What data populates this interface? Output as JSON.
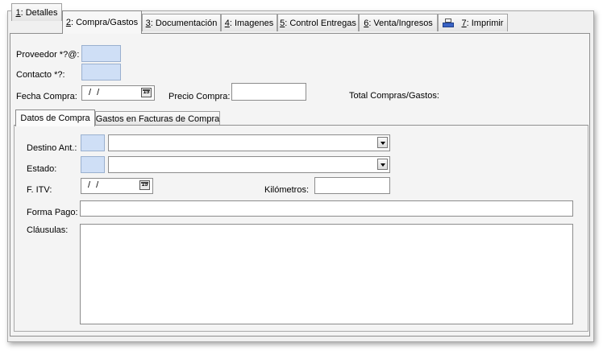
{
  "tabs": [
    {
      "key": "1",
      "rest": ": Detalles"
    },
    {
      "key": "2",
      "rest": ": Compra/Gastos"
    },
    {
      "key": "3",
      "rest": ": Documentación"
    },
    {
      "key": "4",
      "rest": ": Imagenes"
    },
    {
      "key": "5",
      "rest": ": Control Entregas"
    },
    {
      "key": "6",
      "rest": ": Venta/Ingresos"
    },
    {
      "key": "7",
      "rest": ": Imprimir",
      "icon": "printer-icon"
    }
  ],
  "form": {
    "proveedor_label": "Proveedor *?@:",
    "contacto_label": "Contacto *?:",
    "fecha_compra_label": "Fecha Compra:",
    "fecha_compra_value": "/ /",
    "precio_compra_label": "Precio Compra:",
    "total_label": "Total Compras/Gastos:",
    "calendar_glyph": "15"
  },
  "subtabs": [
    "Datos de Compra",
    "Gastos en Facturas de Compra"
  ],
  "sub": {
    "destino_label": "Destino Ant.:",
    "estado_label": "Estado:",
    "fitv_label": "F. ITV:",
    "fitv_value": "/ /",
    "km_label": "Kilómetros:",
    "forma_pago_label": "Forma Pago:",
    "clausulas_label": "Cláusulas:",
    "calendar_glyph": "15"
  }
}
